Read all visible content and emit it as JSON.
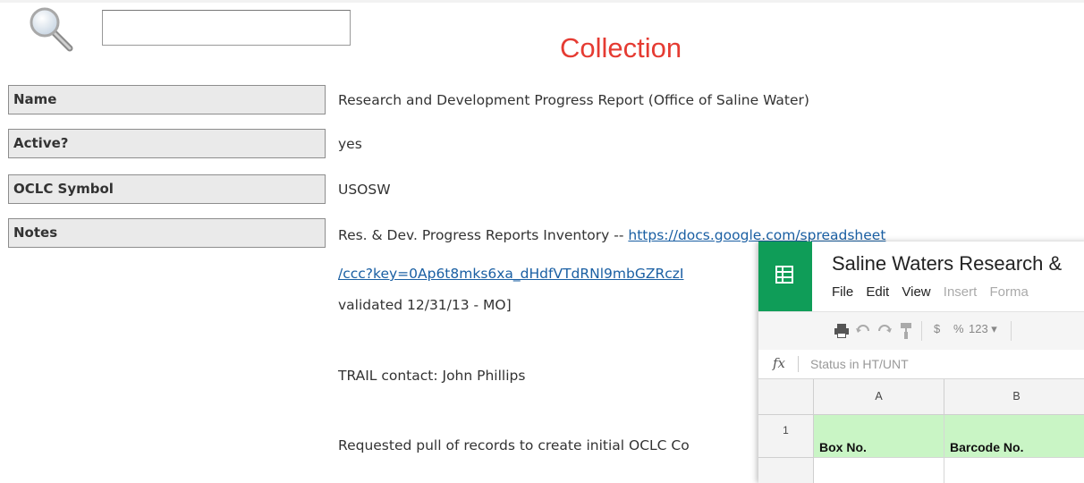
{
  "search": {
    "value": "",
    "placeholder": ""
  },
  "page_title": "Collection",
  "fields": [
    {
      "label": "Name",
      "value": "Research and Development Progress Report (Office of Saline Water)"
    },
    {
      "label": "Active?",
      "value": "yes"
    },
    {
      "label": "OCLC Symbol",
      "value": "USOSW"
    },
    {
      "label": "Notes",
      "value": "Res. & Dev. Progress Reports Inventory -- "
    }
  ],
  "notes": {
    "link_line1": "https://docs.google.com/spreadsheet",
    "link_line2": "/ccc?key=0Ap6t8mks6xa_dHdfVTdRNl9mbGZRczI",
    "validated": "validated 12/31/13 - MO]",
    "trail_contact": "TRAIL contact: John Phillips",
    "requested": "Requested pull of records to create initial OCLC Co"
  },
  "sheet": {
    "title": "Saline Waters Research &",
    "menu": [
      "File",
      "Edit",
      "View",
      "Insert",
      "Forma"
    ],
    "toolbar": {
      "currency": "$",
      "percent": "%",
      "number_format": "123 ▾"
    },
    "formula_label": "fx",
    "formula_text": "Status in HT/UNT",
    "columns": [
      "A",
      "B"
    ],
    "rows": [
      {
        "num": "1",
        "cells": [
          "Box No.",
          "Barcode No."
        ]
      }
    ]
  },
  "colors": {
    "title": "#e53b32",
    "sheets_green": "#0f9d58",
    "header_cell": "#c9f5c5",
    "link": "#1a5fa3"
  }
}
